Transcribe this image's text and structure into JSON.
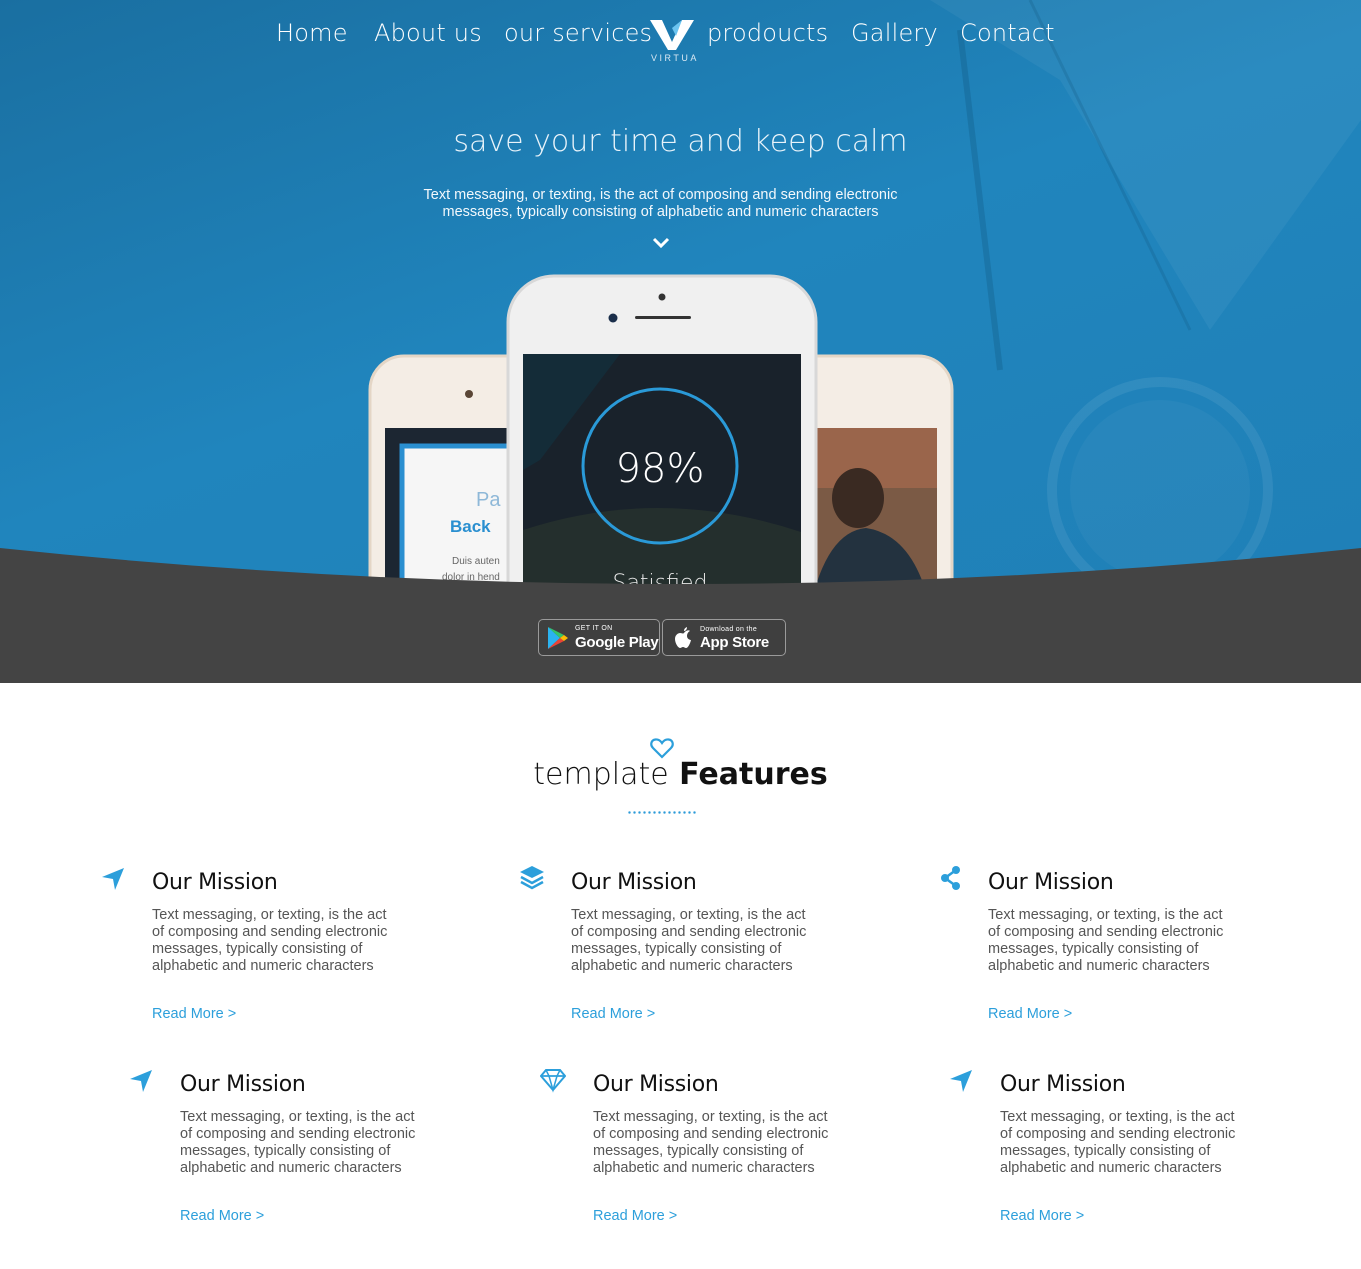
{
  "nav": {
    "items": [
      "Home",
      "About us",
      "our services",
      "prodoucts",
      "Gallery",
      "Contact"
    ],
    "logo_text": "VIRTUA"
  },
  "hero": {
    "headline": "save your time and keep calm",
    "subline": "Text messaging, or texting, is the act of composing and sending electronic messages, typically consisting of alphabetic and numeric characters",
    "phone_center_value": "98%",
    "phone_center_label": "Satisfied",
    "phone_left_text_1": "Pa",
    "phone_left_text_2": "Back",
    "phone_left_text_3": "Duis auten",
    "phone_left_text_4": "dolor in hend"
  },
  "stores": {
    "google_small": "GET IT ON",
    "google_big": "Google Play",
    "apple_small": "Download on the",
    "apple_big": "App Store"
  },
  "features": {
    "title_light": "template",
    "title_bold": "Features",
    "items": [
      {
        "icon": "location-arrow-icon",
        "title": "Our Mission",
        "text": "Text messaging, or texting, is the act of composing and sending electronic messages, typically consisting of alphabetic and numeric characters",
        "link": "Read More >"
      },
      {
        "icon": "layers-icon",
        "title": "Our Mission",
        "text": "Text messaging, or texting, is the act of composing and sending electronic messages, typically consisting of alphabetic and numeric characters",
        "link": "Read More >"
      },
      {
        "icon": "share-icon",
        "title": "Our Mission",
        "text": "Text messaging, or texting, is the act of composing and sending electronic messages, typically consisting of alphabetic and numeric characters",
        "link": "Read More >"
      },
      {
        "icon": "location-arrow-icon",
        "title": "Our Mission",
        "text": "Text messaging, or texting, is the act of composing and sending electronic messages, typically consisting of alphabetic and numeric characters",
        "link": "Read More >"
      },
      {
        "icon": "diamond-icon",
        "title": "Our Mission",
        "text": "Text messaging, or texting, is the act of composing and sending electronic messages, typically consisting of alphabetic and numeric characters",
        "link": "Read More >"
      },
      {
        "icon": "location-arrow-icon",
        "title": "Our Mission",
        "text": "Text messaging, or texting, is the act of composing and sending electronic messages, typically consisting of alphabetic and numeric characters",
        "link": "Read More >"
      }
    ]
  },
  "colors": {
    "hero_blue": "#1f7fb6",
    "dark_band": "#444444",
    "accent": "#2c9fdb"
  }
}
